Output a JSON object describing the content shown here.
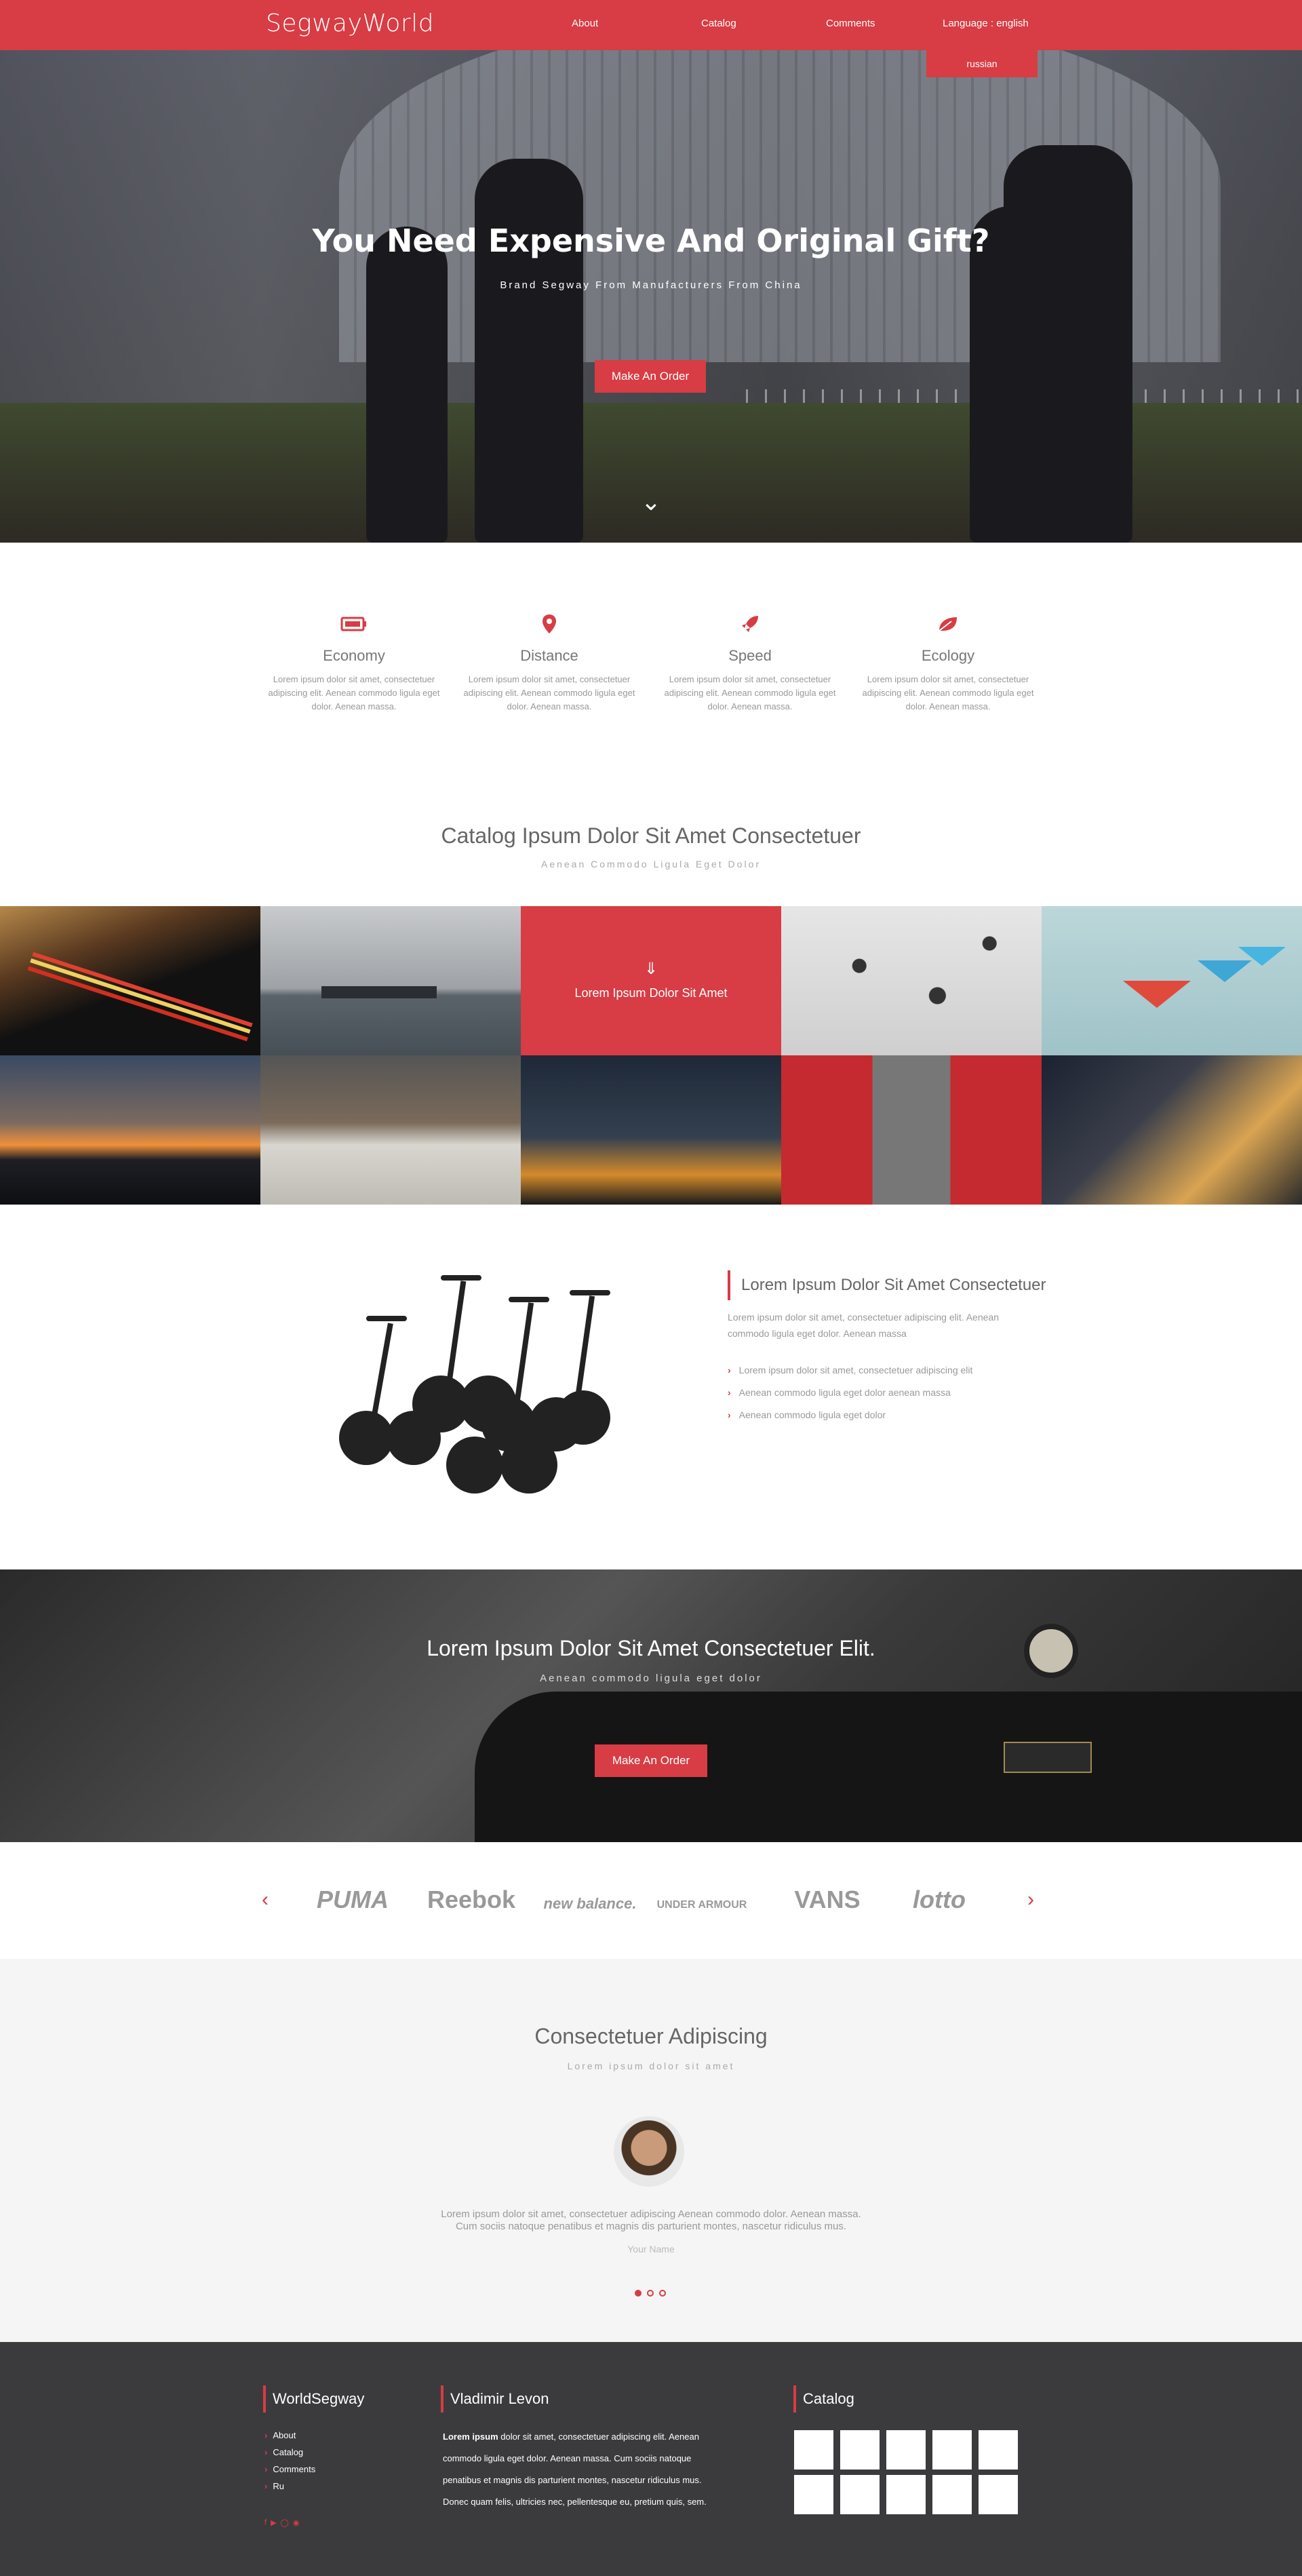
{
  "header": {
    "logo": "SegwayWorld",
    "nav": [
      "About",
      "Catalog",
      "Comments",
      "Language : english"
    ],
    "dropdown_option": "russian"
  },
  "hero": {
    "title": "You Need Expensive And Original Gift?",
    "subtitle": "Brand Segway From Manufacturers From China",
    "button": "Make An Order"
  },
  "features": [
    {
      "icon": "battery-icon",
      "title": "Economy",
      "text": "Lorem ipsum dolor sit amet, consectetuer adipiscing elit. Aenean commodo ligula eget dolor. Aenean massa."
    },
    {
      "icon": "map-pin-icon",
      "title": "Distance",
      "text": "Lorem ipsum dolor sit amet, consectetuer adipiscing elit. Aenean commodo ligula eget dolor. Aenean massa."
    },
    {
      "icon": "rocket-icon",
      "title": "Speed",
      "text": "Lorem ipsum dolor sit amet, consectetuer adipiscing elit. Aenean commodo ligula eget dolor. Aenean massa."
    },
    {
      "icon": "leaf-icon",
      "title": "Ecology",
      "text": "Lorem ipsum dolor sit amet, consectetuer adipiscing elit. Aenean commodo ligula eget dolor. Aenean massa."
    }
  ],
  "catalog": {
    "title": "Catalog Ipsum Dolor Sit Amet Consectetuer",
    "subtitle": "Aenean Commodo Ligula Eget Dolor",
    "hover_label": "Lorem Ipsum Dolor Sit Amet"
  },
  "product": {
    "title": "Lorem Ipsum Dolor Sit Amet Consectetuer",
    "desc": "Lorem ipsum dolor sit amet, consectetuer adipiscing elit. Aenean commodo ligula eget dolor. Aenean massa",
    "items": [
      "Lorem ipsum dolor sit amet, consectetuer adipiscing elit",
      "Aenean commodo ligula eget dolor aenean massa",
      "Aenean commodo ligula eget dolor"
    ]
  },
  "promo": {
    "title": "Lorem Ipsum Dolor Sit Amet Consectetuer  Elit.",
    "subtitle": "Aenean commodo ligula eget dolor",
    "button": "Make An Order"
  },
  "brands": [
    "PUMA",
    "Reebok",
    "new balance.",
    "UNDER ARMOUR",
    "VANS",
    "lotto"
  ],
  "testimonials": {
    "title": "Consectetuer Adipiscing",
    "subtitle": "Lorem ipsum dolor sit amet",
    "quote_1": "Lorem ipsum dolor sit amet, consectetuer adipiscing Aenean commodo dolor. Aenean massa.",
    "quote_2": "Cum sociis natoque penatibus et magnis dis parturient montes, nascetur ridiculus mus.",
    "name": "Your Name"
  },
  "footer": {
    "col1_title": "WorldSegway",
    "links": [
      "About",
      "Catalog",
      "Comments",
      "Ru"
    ],
    "col2_title": "Vladimir Levon",
    "col2_bold": "Lorem ipsum",
    "col2_lines": [
      "dolor sit amet, consectetuer adipiscing elit. Aenean",
      "commodo ligula eget dolor. Aenean massa. Cum sociis natoque",
      "penatibus et magnis dis parturient montes, nascetur ridiculus mus.",
      "Donec quam felis, ultricies nec, pellentesque eu, pretium quis, sem."
    ],
    "col3_title": "Catalog"
  },
  "colors": {
    "accent": "#d83c44",
    "footer_bg": "#3b3b3d",
    "testimonial_bg": "#f5f5f5"
  }
}
